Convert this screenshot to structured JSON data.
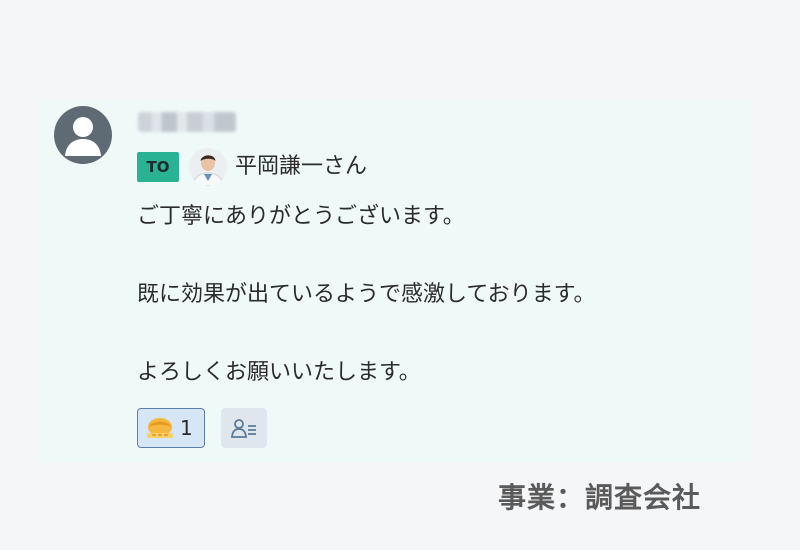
{
  "message": {
    "sender_name": "",
    "to_badge": "TO",
    "to_recipient": "平岡謙一さん",
    "lines": [
      "ご丁寧にありがとうございます。",
      "既に効果が出ているようで感激しております。",
      "よろしくお願いいたします。"
    ],
    "reaction": {
      "emoji_icon": "bowing-emoji-icon",
      "count": "1"
    },
    "readers_icon": "readers-list-icon"
  },
  "caption": "事業：調査会社",
  "colors": {
    "card_background": "#effaf8",
    "page_background": "#f5f6f8",
    "to_badge": "#29b293",
    "avatar": "#5f6b74",
    "reaction_border": "#5a7fb0",
    "reaction_background": "#d6e6f6"
  }
}
